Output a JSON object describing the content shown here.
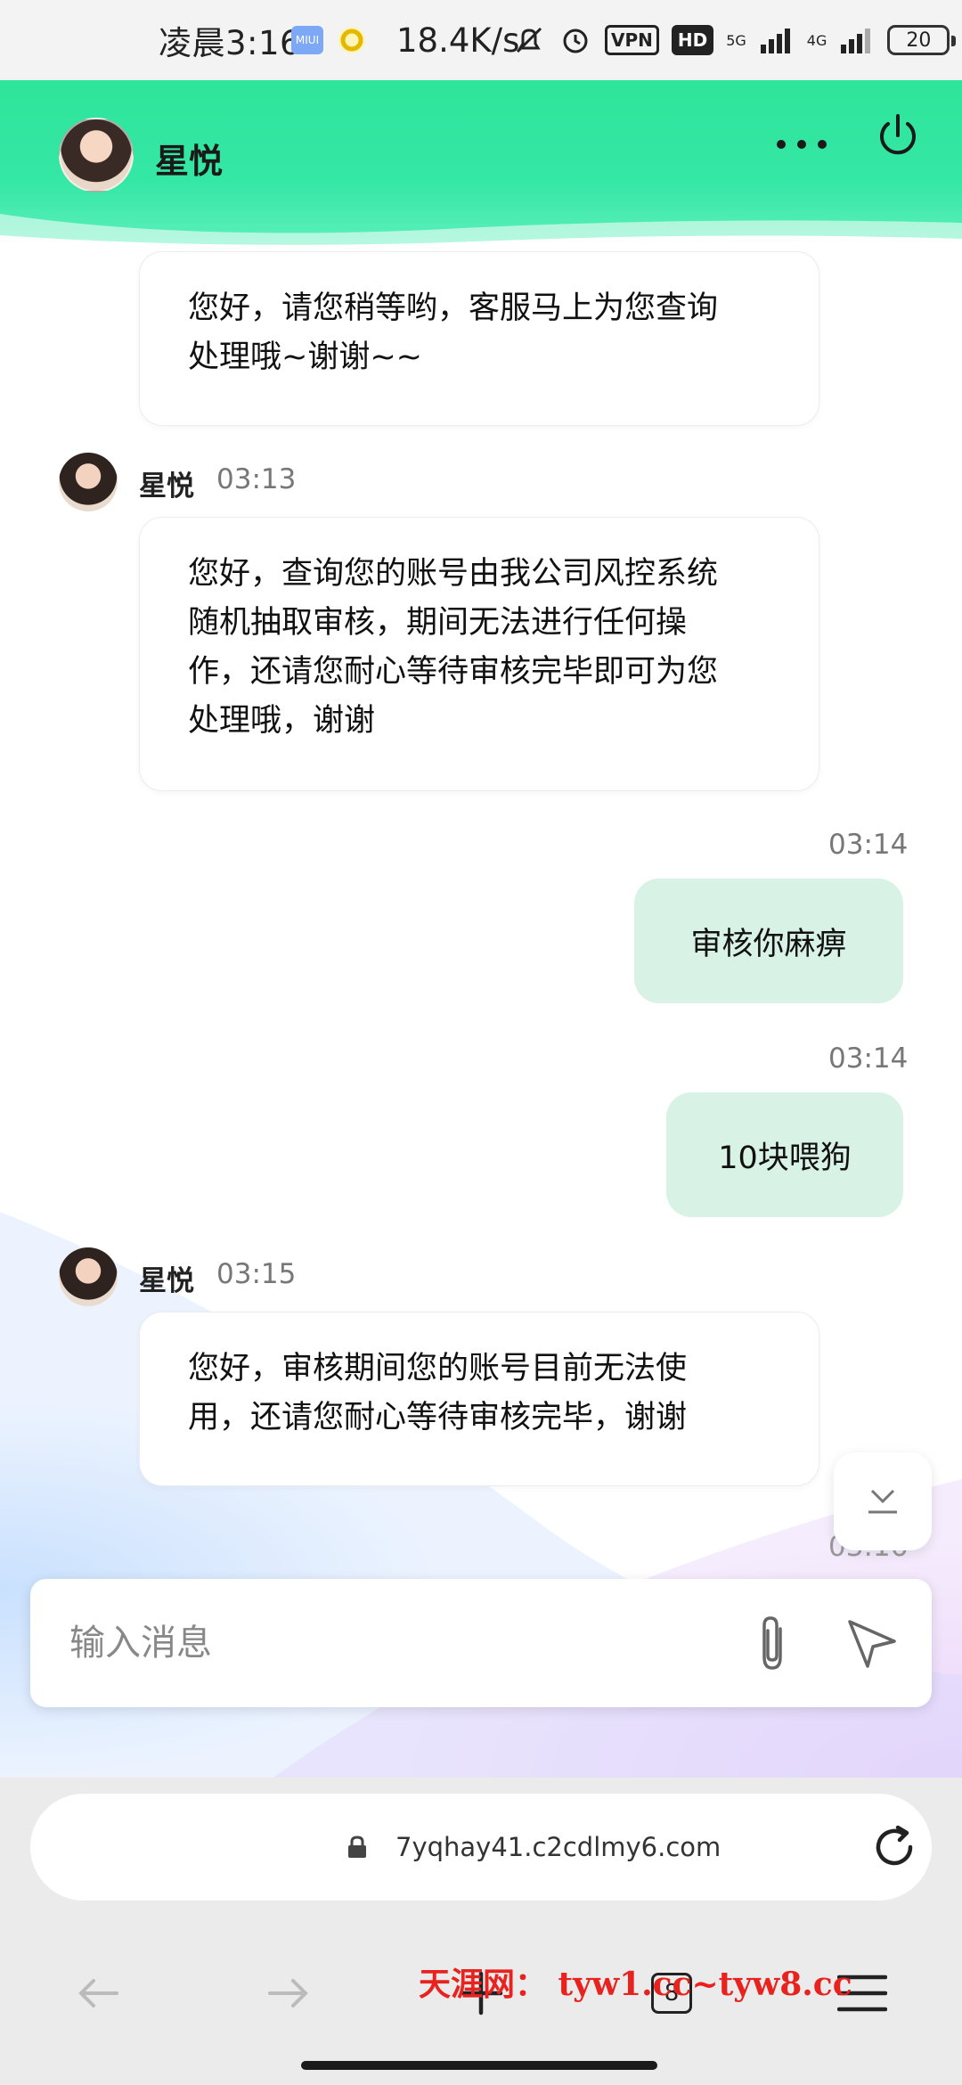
{
  "status_bar": {
    "time": "凌晨3:16",
    "miui_badge": "MIUI",
    "net_speed": "18.4K/s",
    "vpn": "VPN",
    "hd": "HD",
    "net1": "5G",
    "net2": "4G",
    "battery": "20"
  },
  "header": {
    "title": "星悦"
  },
  "messages": [
    {
      "side": "agent",
      "text": "您好，请您稍等哟，客服马上为您查询处理哦~谢谢~~",
      "line1": "您好，请您稍等哟，客服马上为您查询",
      "line2": "处理哦~谢谢~~"
    },
    {
      "side": "agent",
      "name": "星悦",
      "time": "03:13",
      "line1": "您好，查询您的账号由我公司风控系统",
      "line2": "随机抽取审核，期间无法进行任何操",
      "line3": "作，还请您耐心等待审核完毕即可为您",
      "line4": "处理哦，谢谢"
    },
    {
      "side": "user",
      "time": "03:14",
      "text": "审核你麻痹"
    },
    {
      "side": "user",
      "time": "03:14",
      "text": "10块喂狗"
    },
    {
      "side": "agent",
      "name": "星悦",
      "time": "03:15",
      "line1": "您好，审核期间您的账号目前无法使",
      "line2": "用，还请您耐心等待审核完毕，谢谢"
    }
  ],
  "input": {
    "placeholder": "输入消息"
  },
  "browser": {
    "url": "7yqhay41.c2cdlmy6.com",
    "tab_count": "8"
  },
  "watermark": "天涯网： tyw1.cc~tyw8.cc",
  "colors": {
    "header_green": "#2ee59b",
    "user_bubble": "#d9f2e6",
    "watermark_red": "#e8231f"
  },
  "icons": [
    "more-icon",
    "power-icon",
    "attach-icon",
    "send-icon",
    "lock-icon",
    "reload-icon",
    "back-icon",
    "forward-icon",
    "add-tab-icon",
    "menu-icon",
    "scroll-down-icon"
  ]
}
